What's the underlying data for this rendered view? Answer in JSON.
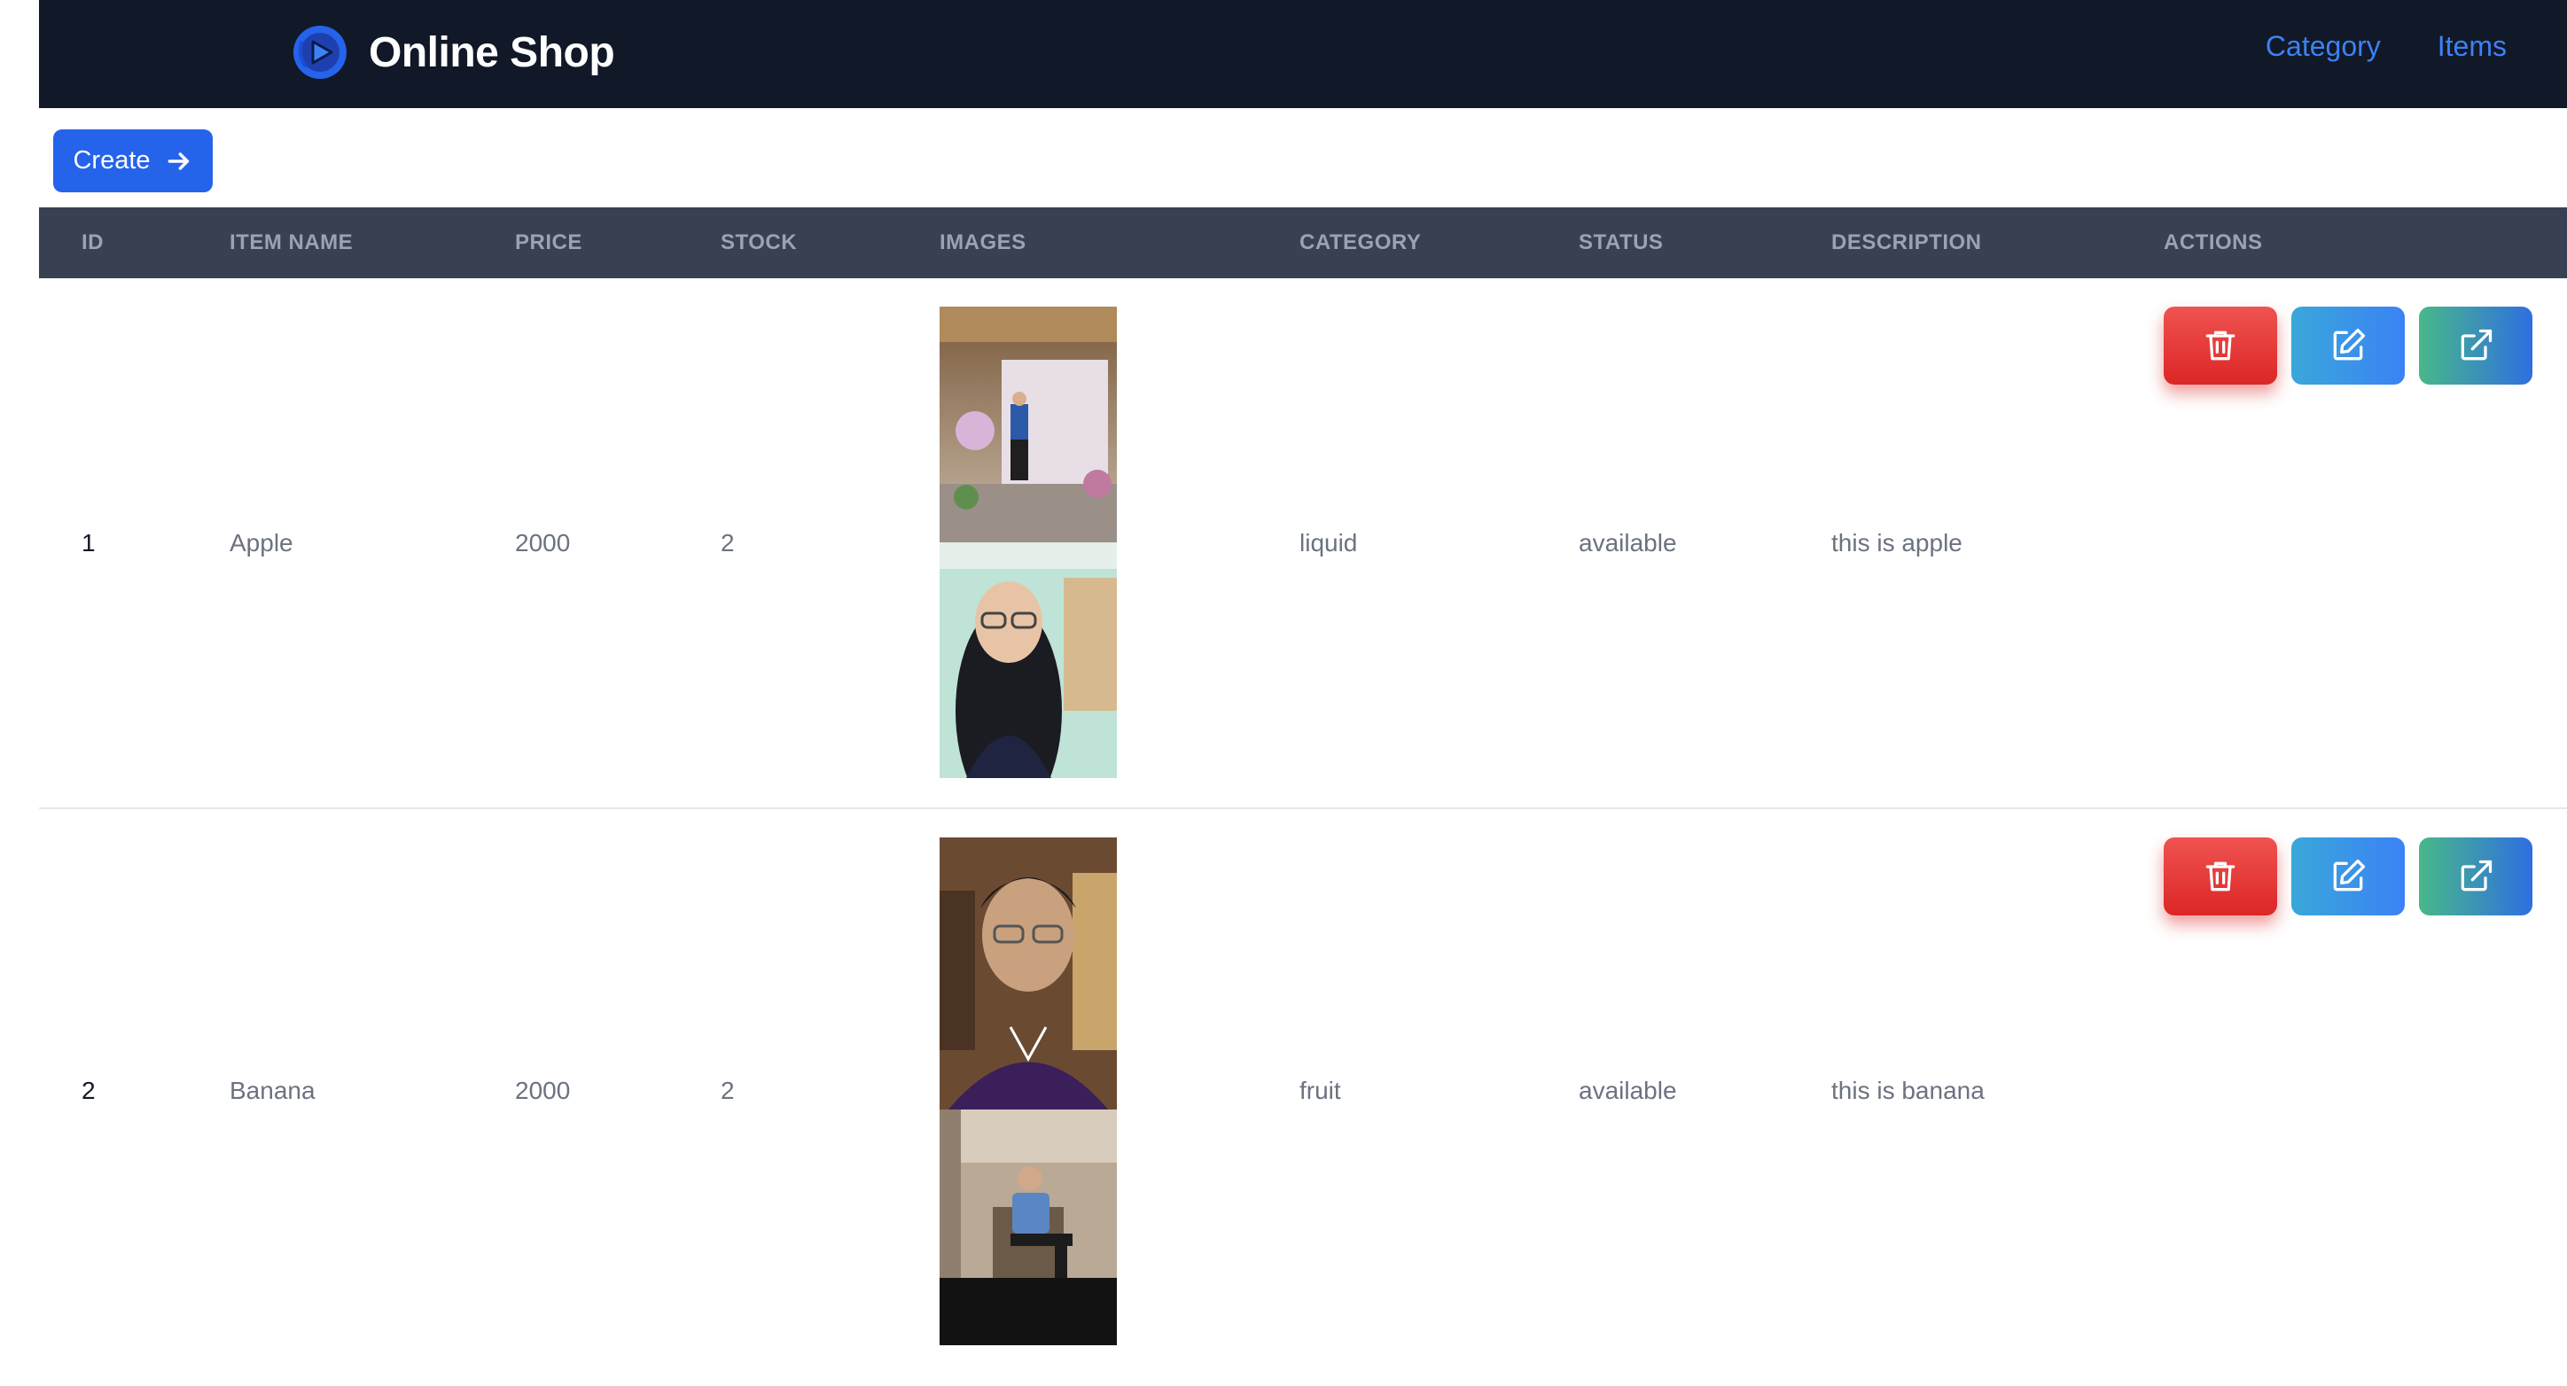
{
  "header": {
    "brand_name": "Online Shop",
    "nav": [
      {
        "label": "Category"
      },
      {
        "label": "Items"
      }
    ]
  },
  "toolbar": {
    "create_label": "Create"
  },
  "table": {
    "columns": [
      "ID",
      "ITEM NAME",
      "PRICE",
      "STOCK",
      "IMAGES",
      "CATEGORY",
      "STATUS",
      "DESCRIPTION",
      "ACTIONS"
    ],
    "rows": [
      {
        "id": "1",
        "name": "Apple",
        "price": "2000",
        "stock": "2",
        "category": "liquid",
        "status": "available",
        "description": "this is apple",
        "image_count": 2
      },
      {
        "id": "2",
        "name": "Banana",
        "price": "2000",
        "stock": "2",
        "category": "fruit",
        "status": "available",
        "description": "this is banana",
        "image_count": 2
      }
    ]
  },
  "icons": {
    "logo": "play-logo-icon",
    "create": "arrow-right-icon",
    "delete": "trash-icon",
    "edit": "edit-icon",
    "open": "external-link-icon"
  },
  "colors": {
    "navbar_bg": "#111827",
    "link": "#3b82f6",
    "primary_button": "#2563eb",
    "table_header_bg": "#374151",
    "delete": "#dc2626",
    "edit": "#3b82f6",
    "open": "#48b88a"
  }
}
